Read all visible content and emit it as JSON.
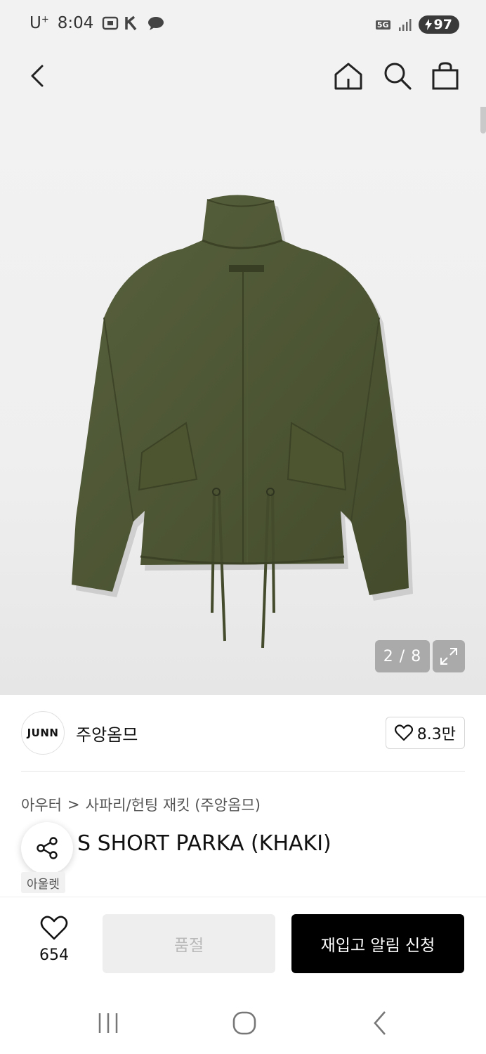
{
  "status_bar": {
    "carrier": "U",
    "carrier_sup": "+",
    "time": "8:04",
    "network": "5G",
    "battery": "97"
  },
  "header": {
    "icons": [
      "back-icon",
      "home-icon",
      "search-icon",
      "shopping-bag-icon"
    ]
  },
  "gallery": {
    "counter": "2 / 8",
    "icons": [
      "expand-icon"
    ]
  },
  "brand": {
    "logo_text": "JUNN",
    "name": "주앙옴므",
    "likes": "8.3만"
  },
  "breadcrumb": {
    "category": "아우터",
    "separator": ">",
    "subcategory": "사파리/헌팅 재킷 (주앙옴므)"
  },
  "product": {
    "title": "S SHORT PARKA (KHAKI)",
    "tag": "아울렛"
  },
  "actions": {
    "wish_count": "654",
    "soldout_label": "품절",
    "restock_label": "재입고 알림 신청"
  },
  "colors": {
    "jacket": "#4b5533",
    "primary_button": "#000000",
    "disabled_button": "#eeeeee"
  }
}
